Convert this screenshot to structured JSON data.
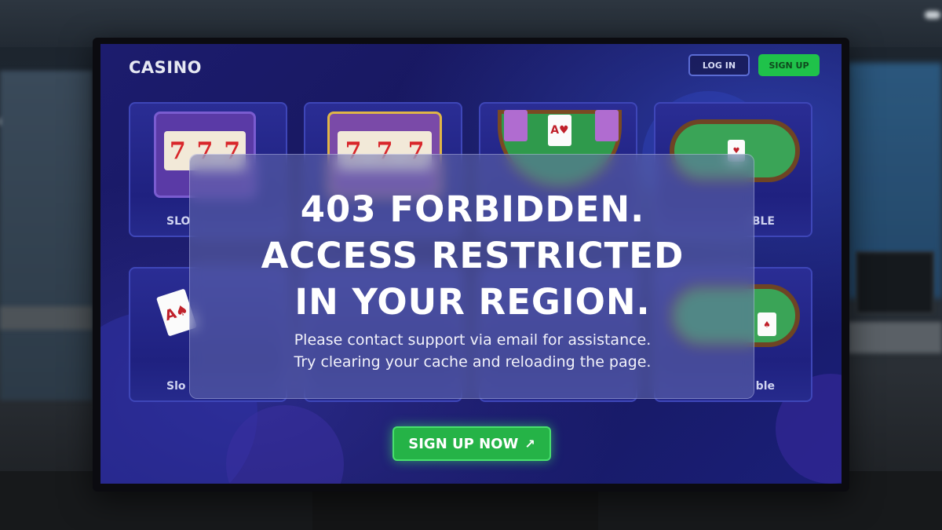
{
  "header": {
    "brand": "CASINO",
    "login_label": "LOG IN",
    "signup_label": "SIGN UP"
  },
  "cards": [
    {
      "label": "SLO"
    },
    {
      "label": ""
    },
    {
      "label": ""
    },
    {
      "label": "BLE"
    },
    {
      "label": "Slo"
    },
    {
      "label": ""
    },
    {
      "label": ""
    },
    {
      "label": "ble"
    }
  ],
  "error": {
    "line1": "403 FORBIDDEN.",
    "line2": "ACCESS RESTRICTED",
    "line3": "IN YOUR REGION.",
    "message1": "Please contact support via email for assistance.",
    "message2": "Try clearing your cache and reloading the page."
  },
  "cta": {
    "label": "SIGN UP NOW",
    "icon": "arrow-up-right-icon"
  },
  "colors": {
    "accent_green": "#25b347",
    "screen_bg": "#1c1c6e",
    "card_border": "#3e46b8"
  }
}
